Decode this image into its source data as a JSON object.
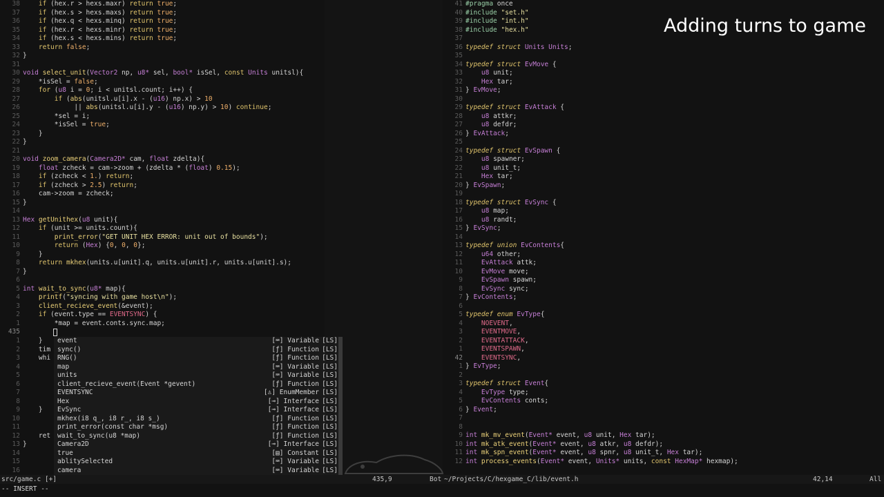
{
  "caption": "Adding turns to game",
  "left_code": [
    {
      "n": "38",
      "html": "    <span class=\"k\">if</span> (hex.r > hexs.maxr) <span class=\"k\">return</span> <span class=\"n\">true</span>;"
    },
    {
      "n": "37",
      "html": "    <span class=\"k\">if</span> (hex.s > hexs.maxs) <span class=\"k\">return</span> <span class=\"n\">true</span>;"
    },
    {
      "n": "36",
      "html": "    <span class=\"k\">if</span> (hex.q < hexs.minq) <span class=\"k\">return</span> <span class=\"n\">true</span>;"
    },
    {
      "n": "35",
      "html": "    <span class=\"k\">if</span> (hex.r < hexs.minr) <span class=\"k\">return</span> <span class=\"n\">true</span>;"
    },
    {
      "n": "34",
      "html": "    <span class=\"k\">if</span> (hex.s < hexs.mins) <span class=\"k\">return</span> <span class=\"n\">true</span>;"
    },
    {
      "n": "33",
      "html": "    <span class=\"k\">return</span> <span class=\"n\">false</span>;"
    },
    {
      "n": "32",
      "html": "}"
    },
    {
      "n": "31",
      "html": ""
    },
    {
      "n": "30",
      "html": "<span class=\"t\">void</span> <span class=\"f\">select_unit</span>(<span class=\"t\">Vector2</span> np, <span class=\"t\">u8*</span> sel, <span class=\"t\">bool*</span> isSel, <span class=\"k\">const</span> <span class=\"t\">Units</span> unitsl){"
    },
    {
      "n": "29",
      "html": "    *isSel = <span class=\"n\">false</span>;"
    },
    {
      "n": "28",
      "html": "    <span class=\"k\">for</span> (<span class=\"t\">u8</span> i = <span class=\"n\">0</span>; i < unitsl.count; i++) {"
    },
    {
      "n": "27",
      "html": "        <span class=\"k\">if</span> (<span class=\"f\">abs</span>(unitsl.u[i].x - (<span class=\"t\">u16</span>) np.x) > <span class=\"n\">10</span>"
    },
    {
      "n": "26",
      "html": "             || <span class=\"f\">abs</span>(unitsl.u[i].y - (<span class=\"t\">u16</span>) np.y) > <span class=\"n\">10</span>) <span class=\"k\">continue</span>;"
    },
    {
      "n": "25",
      "html": "        *sel = i;"
    },
    {
      "n": "24",
      "html": "        *isSel = <span class=\"n\">true</span>;"
    },
    {
      "n": "23",
      "html": "    }"
    },
    {
      "n": "22",
      "html": "}"
    },
    {
      "n": "21",
      "html": ""
    },
    {
      "n": "20",
      "html": "<span class=\"t\">void</span> <span class=\"f\">zoom_camera</span>(<span class=\"t\">Camera2D*</span> cam, <span class=\"t\">float</span> zdelta){"
    },
    {
      "n": "19",
      "html": "    <span class=\"t\">float</span> zcheck = cam->zoom + (zdelta * (<span class=\"t\">float</span>) <span class=\"n\">0.15</span>);"
    },
    {
      "n": "18",
      "html": "    <span class=\"k\">if</span> (zcheck < <span class=\"n\">1.</span>) <span class=\"k\">return</span>;"
    },
    {
      "n": "17",
      "html": "    <span class=\"k\">if</span> (zcheck > <span class=\"n\">2.5</span>) <span class=\"k\">return</span>;"
    },
    {
      "n": "16",
      "html": "    cam->zoom = zcheck;"
    },
    {
      "n": "15",
      "html": "}"
    },
    {
      "n": "14",
      "html": ""
    },
    {
      "n": "13",
      "html": "<span class=\"t\">Hex</span> <span class=\"f\">getUnithex</span>(<span class=\"t\">u8</span> unit){"
    },
    {
      "n": "12",
      "html": "    <span class=\"k\">if</span> (unit >= units.count){"
    },
    {
      "n": "11",
      "html": "        <span class=\"f\">print_error</span>(<span class=\"s\">\"GET UNIT HEX ERROR: unit out of bounds\"</span>);"
    },
    {
      "n": "10",
      "html": "        <span class=\"k\">return</span> (<span class=\"t\">Hex</span>) {<span class=\"n\">0</span>, <span class=\"n\">0</span>, <span class=\"n\">0</span>};"
    },
    {
      "n": "9",
      "html": "    }"
    },
    {
      "n": "8",
      "html": "    <span class=\"k\">return</span> <span class=\"f\">mkhex</span>(units.u[unit].q, units.u[unit].r, units.u[unit].s);"
    },
    {
      "n": "7",
      "html": "}"
    },
    {
      "n": "6",
      "html": ""
    },
    {
      "n": "5",
      "html": "<span class=\"t\">int</span> <span class=\"f\">wait_to_sync</span>(<span class=\"t\">u8*</span> map){"
    },
    {
      "n": "4",
      "html": "    <span class=\"f\">printf</span>(<span class=\"s\">\"syncing with game host\\n\"</span>);"
    },
    {
      "n": "3",
      "html": "    <span class=\"f\">client_recieve_event</span>(&event);"
    },
    {
      "n": "2",
      "html": "    <span class=\"k\">if</span> (event.type == <span class=\"e\">EVENTSYNC</span>) {"
    },
    {
      "n": "1",
      "html": "        *map = event.conts.sync.map;"
    },
    {
      "n": "435",
      "html": ""
    }
  ],
  "left_behind": [
    {
      "n": "1",
      "txt": "    }"
    },
    {
      "n": "2",
      "txt": "    tim"
    },
    {
      "n": "3",
      "txt": "    whi"
    },
    {
      "n": "4",
      "txt": ""
    },
    {
      "n": "5",
      "txt": ""
    },
    {
      "n": "6",
      "txt": ""
    },
    {
      "n": "7",
      "txt": ""
    },
    {
      "n": "8",
      "txt": ""
    },
    {
      "n": "9",
      "txt": "    }"
    },
    {
      "n": "10",
      "txt": ""
    },
    {
      "n": "11",
      "txt": ""
    },
    {
      "n": "12",
      "txt": "    ret"
    },
    {
      "n": "13",
      "txt": "}"
    },
    {
      "n": "14",
      "txt": ""
    },
    {
      "n": "15",
      "txt": ""
    },
    {
      "n": "16",
      "txt": ""
    }
  ],
  "completion": [
    {
      "label": "event",
      "kind": "[⌨] Variable",
      "src": "[LS]"
    },
    {
      "label": "sync()",
      "kind": "[ƒ] Function",
      "src": "[LS]"
    },
    {
      "label": "RNG()",
      "kind": "[ƒ] Function",
      "src": "[LS]"
    },
    {
      "label": "map",
      "kind": "[⌨] Variable",
      "src": "[LS]"
    },
    {
      "label": "units",
      "kind": "[⌨] Variable",
      "src": "[LS]"
    },
    {
      "label": "client_recieve_event(Event *gevent)",
      "kind": "[ƒ] Function",
      "src": "[LS]"
    },
    {
      "label": "EVENTSYNC",
      "kind": "[♙] EnumMember",
      "src": "[LS]"
    },
    {
      "label": "Hex",
      "kind": "[⊸] Interface",
      "src": "[LS]"
    },
    {
      "label": "EvSync",
      "kind": "[⊸] Interface",
      "src": "[LS]"
    },
    {
      "label": "mkhex(i8 q_, i8 r_, i8 s_)",
      "kind": "[ƒ] Function",
      "src": "[LS]"
    },
    {
      "label": "print_error(const char *msg)",
      "kind": "[ƒ] Function",
      "src": "[LS]"
    },
    {
      "label": "wait_to_sync(u8 *map)",
      "kind": "[ƒ] Function",
      "src": "[LS]"
    },
    {
      "label": "Camera2D",
      "kind": "[⊸] Interface",
      "src": "[LS]"
    },
    {
      "label": "true",
      "kind": "[▤] Constant",
      "src": "[LS]"
    },
    {
      "label": "ablitySelected",
      "kind": "[⌨] Variable",
      "src": "[LS]"
    },
    {
      "label": "camera",
      "kind": "[⌨] Variable",
      "src": "[LS]"
    }
  ],
  "right_code": [
    {
      "n": "41",
      "html": "<span class=\"p\">#pragma</span> once"
    },
    {
      "n": "40",
      "html": "<span class=\"p\">#include</span> <span class=\"s\">\"set.h\"</span>"
    },
    {
      "n": "39",
      "html": "<span class=\"p\">#include</span> <span class=\"s\">\"int.h\"</span>"
    },
    {
      "n": "38",
      "html": "<span class=\"p\">#include</span> <span class=\"s\">\"hex.h\"</span>"
    },
    {
      "n": "37",
      "html": ""
    },
    {
      "n": "36",
      "html": "<span class=\"i\">typedef struct</span> <span class=\"t\">Units Units</span>;"
    },
    {
      "n": "35",
      "html": ""
    },
    {
      "n": "34",
      "html": "<span class=\"i\">typedef struct</span> <span class=\"t\">EvMove</span> {"
    },
    {
      "n": "33",
      "html": "    <span class=\"t\">u8</span> unit;"
    },
    {
      "n": "32",
      "html": "    <span class=\"t\">Hex</span> tar;"
    },
    {
      "n": "31",
      "html": "} <span class=\"t\">EvMove</span>;"
    },
    {
      "n": "30",
      "html": ""
    },
    {
      "n": "29",
      "html": "<span class=\"i\">typedef struct</span> <span class=\"t\">EvAttack</span> {"
    },
    {
      "n": "28",
      "html": "    <span class=\"t\">u8</span> attkr;"
    },
    {
      "n": "27",
      "html": "    <span class=\"t\">u8</span> defdr;"
    },
    {
      "n": "26",
      "html": "} <span class=\"t\">EvAttack</span>;"
    },
    {
      "n": "25",
      "html": ""
    },
    {
      "n": "24",
      "html": "<span class=\"i\">typedef struct</span> <span class=\"t\">EvSpawn</span> {"
    },
    {
      "n": "23",
      "html": "    <span class=\"t\">u8</span> spawner;"
    },
    {
      "n": "22",
      "html": "    <span class=\"t\">u8</span> unit_t;"
    },
    {
      "n": "21",
      "html": "    <span class=\"t\">Hex</span> tar;"
    },
    {
      "n": "20",
      "html": "} <span class=\"t\">EvSpawn</span>;"
    },
    {
      "n": "19",
      "html": ""
    },
    {
      "n": "18",
      "html": "<span class=\"i\">typedef struct</span> <span class=\"t\">EvSync</span> {"
    },
    {
      "n": "17",
      "html": "    <span class=\"t\">u8</span> map;"
    },
    {
      "n": "16",
      "html": "    <span class=\"t\">u8</span> randt;"
    },
    {
      "n": "15",
      "html": "} <span class=\"t\">EvSync</span>;"
    },
    {
      "n": "14",
      "html": ""
    },
    {
      "n": "13",
      "html": "<span class=\"i\">typedef union</span> <span class=\"t\">EvContents</span>{"
    },
    {
      "n": "12",
      "html": "    <span class=\"t\">u64</span> other;"
    },
    {
      "n": "11",
      "html": "    <span class=\"t\">EvAttack</span> attk;"
    },
    {
      "n": "10",
      "html": "    <span class=\"t\">EvMove</span> move;"
    },
    {
      "n": "9",
      "html": "    <span class=\"t\">EvSpawn</span> spawn;"
    },
    {
      "n": "8",
      "html": "    <span class=\"t\">EvSync</span> sync;"
    },
    {
      "n": "7",
      "html": "} <span class=\"t\">EvContents</span>;"
    },
    {
      "n": "6",
      "html": ""
    },
    {
      "n": "5",
      "html": "<span class=\"i\">typedef enum</span> <span class=\"t\">EvType</span>{"
    },
    {
      "n": "4",
      "html": "    <span class=\"e\">NOEVENT</span>,"
    },
    {
      "n": "3",
      "html": "    <span class=\"e\">EVENTMOVE</span>,"
    },
    {
      "n": "2",
      "html": "    <span class=\"e\">EVENTATTACK</span>,"
    },
    {
      "n": "1",
      "html": "    <span class=\"e\">EVENTSPAWN</span>,"
    },
    {
      "n": "42",
      "html": "    <span class=\"e\">EVENTSYNC</span>,"
    },
    {
      "n": "1",
      "html": "} <span class=\"t\">EvType</span>;"
    },
    {
      "n": "2",
      "html": ""
    },
    {
      "n": "3",
      "html": "<span class=\"i\">typedef struct</span> <span class=\"t\">Event</span>{"
    },
    {
      "n": "4",
      "html": "    <span class=\"t\">EvType</span> type;"
    },
    {
      "n": "5",
      "html": "    <span class=\"t\">EvContents</span> conts;"
    },
    {
      "n": "6",
      "html": "} <span class=\"t\">Event</span>;"
    },
    {
      "n": "7",
      "html": ""
    },
    {
      "n": "8",
      "html": ""
    },
    {
      "n": "9",
      "html": "<span class=\"t\">int</span> <span class=\"f\">mk_mv_event</span>(<span class=\"t\">Event*</span> event, <span class=\"t\">u8</span> unit, <span class=\"t\">Hex</span> tar);"
    },
    {
      "n": "10",
      "html": "<span class=\"t\">int</span> <span class=\"f\">mk_atk_event</span>(<span class=\"t\">Event*</span> event, <span class=\"t\">u8</span> atkr, <span class=\"t\">u8</span> defdr);"
    },
    {
      "n": "11",
      "html": "<span class=\"t\">int</span> <span class=\"f\">mk_spn_event</span>(<span class=\"t\">Event*</span> event, <span class=\"t\">u8</span> spnr, <span class=\"t\">u8</span> unit_t, <span class=\"t\">Hex</span> tar);"
    },
    {
      "n": "12",
      "html": "<span class=\"t\">int</span> <span class=\"f\">process_events</span>(<span class=\"t\">Event*</span> event, <span class=\"t\">Units*</span> units, <span class=\"k\">const</span> <span class=\"t\">HexMap*</span> hexmap);"
    }
  ],
  "status": {
    "left_file": "src/game.c [+]",
    "left_pos": "435,9",
    "left_scroll": "Bot",
    "right_file": "~/Projects/C/hexgame_C/lib/event.h",
    "right_pos": "42,14",
    "right_scroll": "All"
  },
  "mode": "-- INSERT --"
}
